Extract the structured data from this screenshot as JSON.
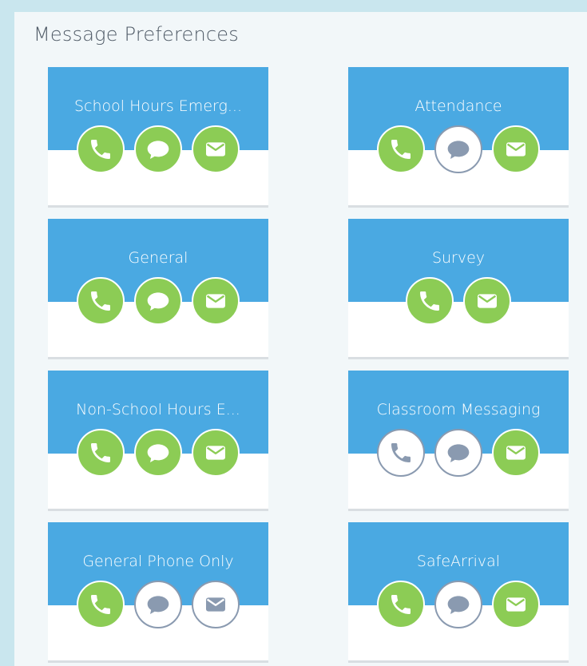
{
  "page": {
    "title": "Message Preferences"
  },
  "colors": {
    "card_header": "#4aa9e2",
    "enabled": "#8ccc55",
    "disabled": "#8a9ab0"
  },
  "cards": [
    {
      "label": "School Hours Emerg...",
      "phone": true,
      "sms": true,
      "email": true
    },
    {
      "label": "Attendance",
      "phone": true,
      "sms": false,
      "email": true
    },
    {
      "label": "General",
      "phone": true,
      "sms": true,
      "email": true
    },
    {
      "label": "Survey",
      "phone": true,
      "email": true
    },
    {
      "label": "Non-School Hours E...",
      "phone": true,
      "sms": true,
      "email": true
    },
    {
      "label": "Classroom Messaging",
      "phone": false,
      "sms": false,
      "email": true
    },
    {
      "label": "General Phone Only",
      "phone": true,
      "sms": false,
      "email": false
    },
    {
      "label": "SafeArrival",
      "phone": true,
      "sms": false,
      "email": true
    }
  ],
  "icon_names": {
    "phone": "phone-icon",
    "sms": "chat-bubble-icon",
    "email": "envelope-icon"
  }
}
